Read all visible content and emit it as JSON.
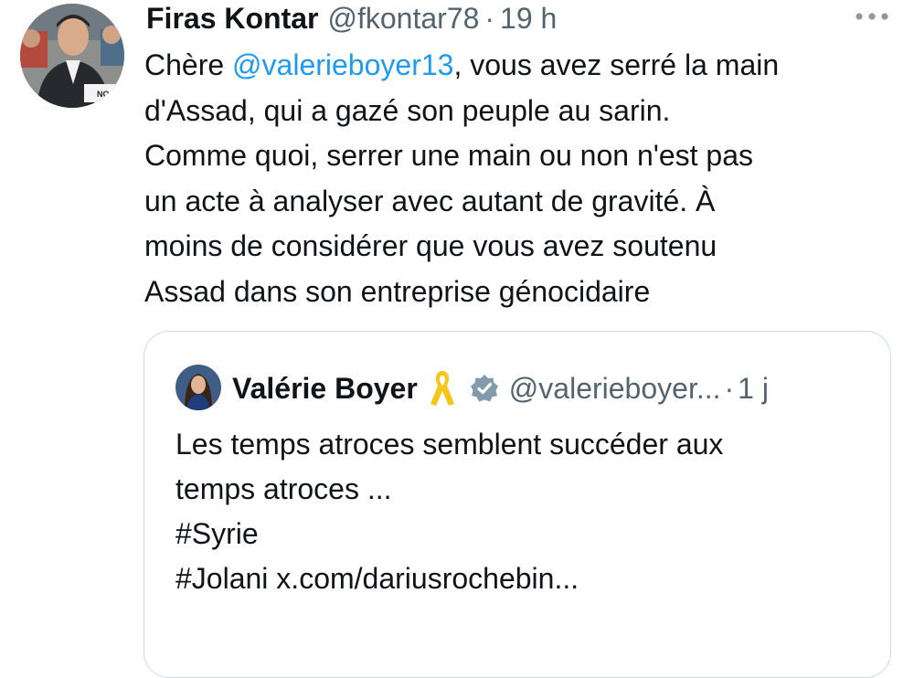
{
  "tweet": {
    "author_name": "Firas Kontar",
    "author_handle": "@fkontar78",
    "separator": "·",
    "time": "19 h",
    "text_lines": [
      {
        "before": "Chère ",
        "mention": "@valerieboyer13",
        "after": ", vous avez serré la main"
      },
      "d'Assad, qui a gazé son peuple au sarin.",
      "Comme quoi, serrer une main ou non n'est pas",
      "un acte à analyser avec autant de gravité. À",
      "moins de considérer que vous avez soutenu",
      "Assad dans son entreprise génocidaire"
    ],
    "more_icon": "more-horizontal-icon"
  },
  "quoted_tweet": {
    "author_name": "Valérie Boyer",
    "author_handle": "@valerieboyer...",
    "separator": "·",
    "time": "1 j",
    "ribbon_icon": "yellow-ribbon-icon",
    "verified_icon": "verified-badge-icon",
    "text_lines": [
      "Les temps atroces semblent succéder aux",
      "temps atroces ...",
      "#Syrie",
      "#Jolani x.com/dariusrochebin..."
    ]
  },
  "colors": {
    "text": "#0f1419",
    "secondary": "#536471",
    "link": "#1d9bf0",
    "border": "#cfd9de",
    "ribbon": "#f5c518",
    "verified": "#829aab"
  }
}
